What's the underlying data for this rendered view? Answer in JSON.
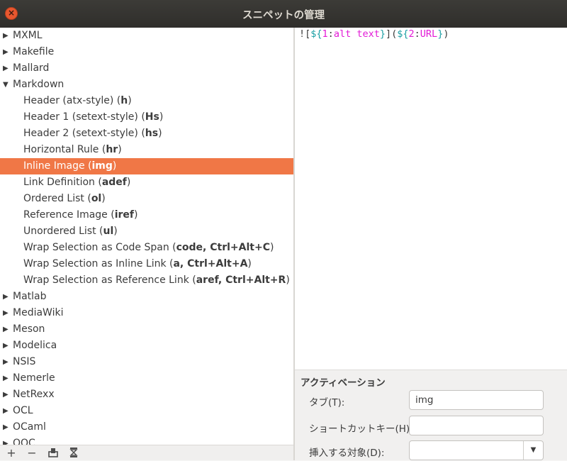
{
  "window": {
    "title": "スニペットの管理"
  },
  "tree": {
    "rows": [
      {
        "kind": "cat",
        "expanded": false,
        "label": "MXML"
      },
      {
        "kind": "cat",
        "expanded": false,
        "label": "Makefile"
      },
      {
        "kind": "cat",
        "expanded": false,
        "label": "Mallard"
      },
      {
        "kind": "cat",
        "expanded": true,
        "label": "Markdown"
      },
      {
        "kind": "snip",
        "label": "Header (atx-style) (",
        "key": "h",
        "end": ")"
      },
      {
        "kind": "snip",
        "label": "Header 1 (setext-style) (",
        "key": "Hs",
        "end": ")"
      },
      {
        "kind": "snip",
        "label": "Header 2 (setext-style) (",
        "key": "hs",
        "end": ")"
      },
      {
        "kind": "snip",
        "label": "Horizontal Rule (",
        "key": "hr",
        "end": ")"
      },
      {
        "kind": "snip",
        "label": "Inline Image (",
        "key": "img",
        "end": ")",
        "selected": true
      },
      {
        "kind": "snip",
        "label": "Link Definition (",
        "key": "adef",
        "end": ")"
      },
      {
        "kind": "snip",
        "label": "Ordered List (",
        "key": "ol",
        "end": ")"
      },
      {
        "kind": "snip",
        "label": "Reference Image (",
        "key": "iref",
        "end": ")"
      },
      {
        "kind": "snip",
        "label": "Unordered List (",
        "key": "ul",
        "end": ")"
      },
      {
        "kind": "snip",
        "label": "Wrap Selection as Code Span (",
        "key": "code, Ctrl+Alt+C",
        "end": ")"
      },
      {
        "kind": "snip",
        "label": "Wrap Selection as Inline Link (",
        "key": "a, Ctrl+Alt+A",
        "end": ")"
      },
      {
        "kind": "snip",
        "label": "Wrap Selection as Reference Link (",
        "key": "aref, Ctrl+Alt+R",
        "end": ")"
      },
      {
        "kind": "cat",
        "expanded": false,
        "label": "Matlab"
      },
      {
        "kind": "cat",
        "expanded": false,
        "label": "MediaWiki"
      },
      {
        "kind": "cat",
        "expanded": false,
        "label": "Meson"
      },
      {
        "kind": "cat",
        "expanded": false,
        "label": "Modelica"
      },
      {
        "kind": "cat",
        "expanded": false,
        "label": "NSIS"
      },
      {
        "kind": "cat",
        "expanded": false,
        "label": "Nemerle"
      },
      {
        "kind": "cat",
        "expanded": false,
        "label": "NetRexx"
      },
      {
        "kind": "cat",
        "expanded": false,
        "label": "OCL"
      },
      {
        "kind": "cat",
        "expanded": false,
        "label": "OCaml"
      },
      {
        "kind": "cat",
        "expanded": false,
        "label": "OOC"
      }
    ]
  },
  "toolbar": {
    "add": "+",
    "remove": "−"
  },
  "editor": {
    "parts": [
      {
        "text": "![",
        "cls": ""
      },
      {
        "text": "${",
        "cls": "c"
      },
      {
        "text": "1",
        "cls": "m"
      },
      {
        "text": ":",
        "cls": ""
      },
      {
        "text": "alt text",
        "cls": "m"
      },
      {
        "text": "}",
        "cls": "c"
      },
      {
        "text": "](",
        "cls": ""
      },
      {
        "text": "${",
        "cls": "c"
      },
      {
        "text": "2",
        "cls": "m"
      },
      {
        "text": ":",
        "cls": ""
      },
      {
        "text": "URL",
        "cls": "m"
      },
      {
        "text": "}",
        "cls": "c"
      },
      {
        "text": ")",
        "cls": ""
      }
    ]
  },
  "activation": {
    "heading": "アクティベーション",
    "tab_label": "タブ(T):",
    "tab_value": "img",
    "shortcut_label": "ショートカットキー(H):",
    "shortcut_value": "",
    "scope_label": "挿入する対象(D):",
    "scope_value": ""
  },
  "colors": {
    "selection": "#f07746",
    "titlebar": "#3c3b37",
    "close": "#e8572f"
  },
  "icons": {
    "close": "close-icon",
    "expander_closed": "triangle-right-icon",
    "expander_open": "triangle-down-icon",
    "import": "import-icon",
    "export": "export-icon"
  }
}
